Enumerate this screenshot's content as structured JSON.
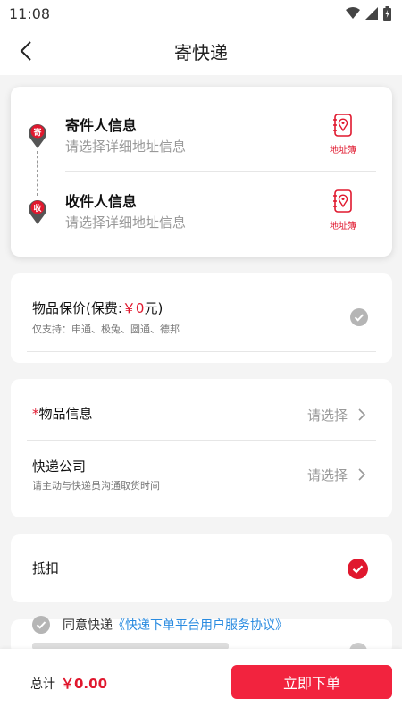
{
  "status": {
    "time": "11:08"
  },
  "nav": {
    "title": "寄快递"
  },
  "sender": {
    "title": "寄件人信息",
    "placeholder": "请选择详细地址信息",
    "pin": "寄",
    "book_label": "地址簿"
  },
  "receiver": {
    "title": "收件人信息",
    "placeholder": "请选择详细地址信息",
    "pin": "收",
    "book_label": "地址簿"
  },
  "insurance": {
    "title_prefix": "物品保价(保费:",
    "fee": "￥0",
    "title_suffix": "元)",
    "note": "仅支持：申通、极兔、圆通、德邦"
  },
  "goods": {
    "required_mark": "*",
    "label": "物品信息",
    "value": "请选择"
  },
  "express": {
    "label": "快递公司",
    "value": "请选择",
    "note": "请主动与快递员沟通取货时间"
  },
  "deduct": {
    "label": "抵扣"
  },
  "agreement": {
    "text": "同意快递",
    "link": "《快递下单平台用户服务协议》"
  },
  "footer": {
    "total_label": "总计",
    "total_amount": "￥0.00",
    "submit_label": "立即下单"
  },
  "colors": {
    "accent": "#e0182e",
    "button": "#f2233e",
    "link": "#2a8be0"
  }
}
